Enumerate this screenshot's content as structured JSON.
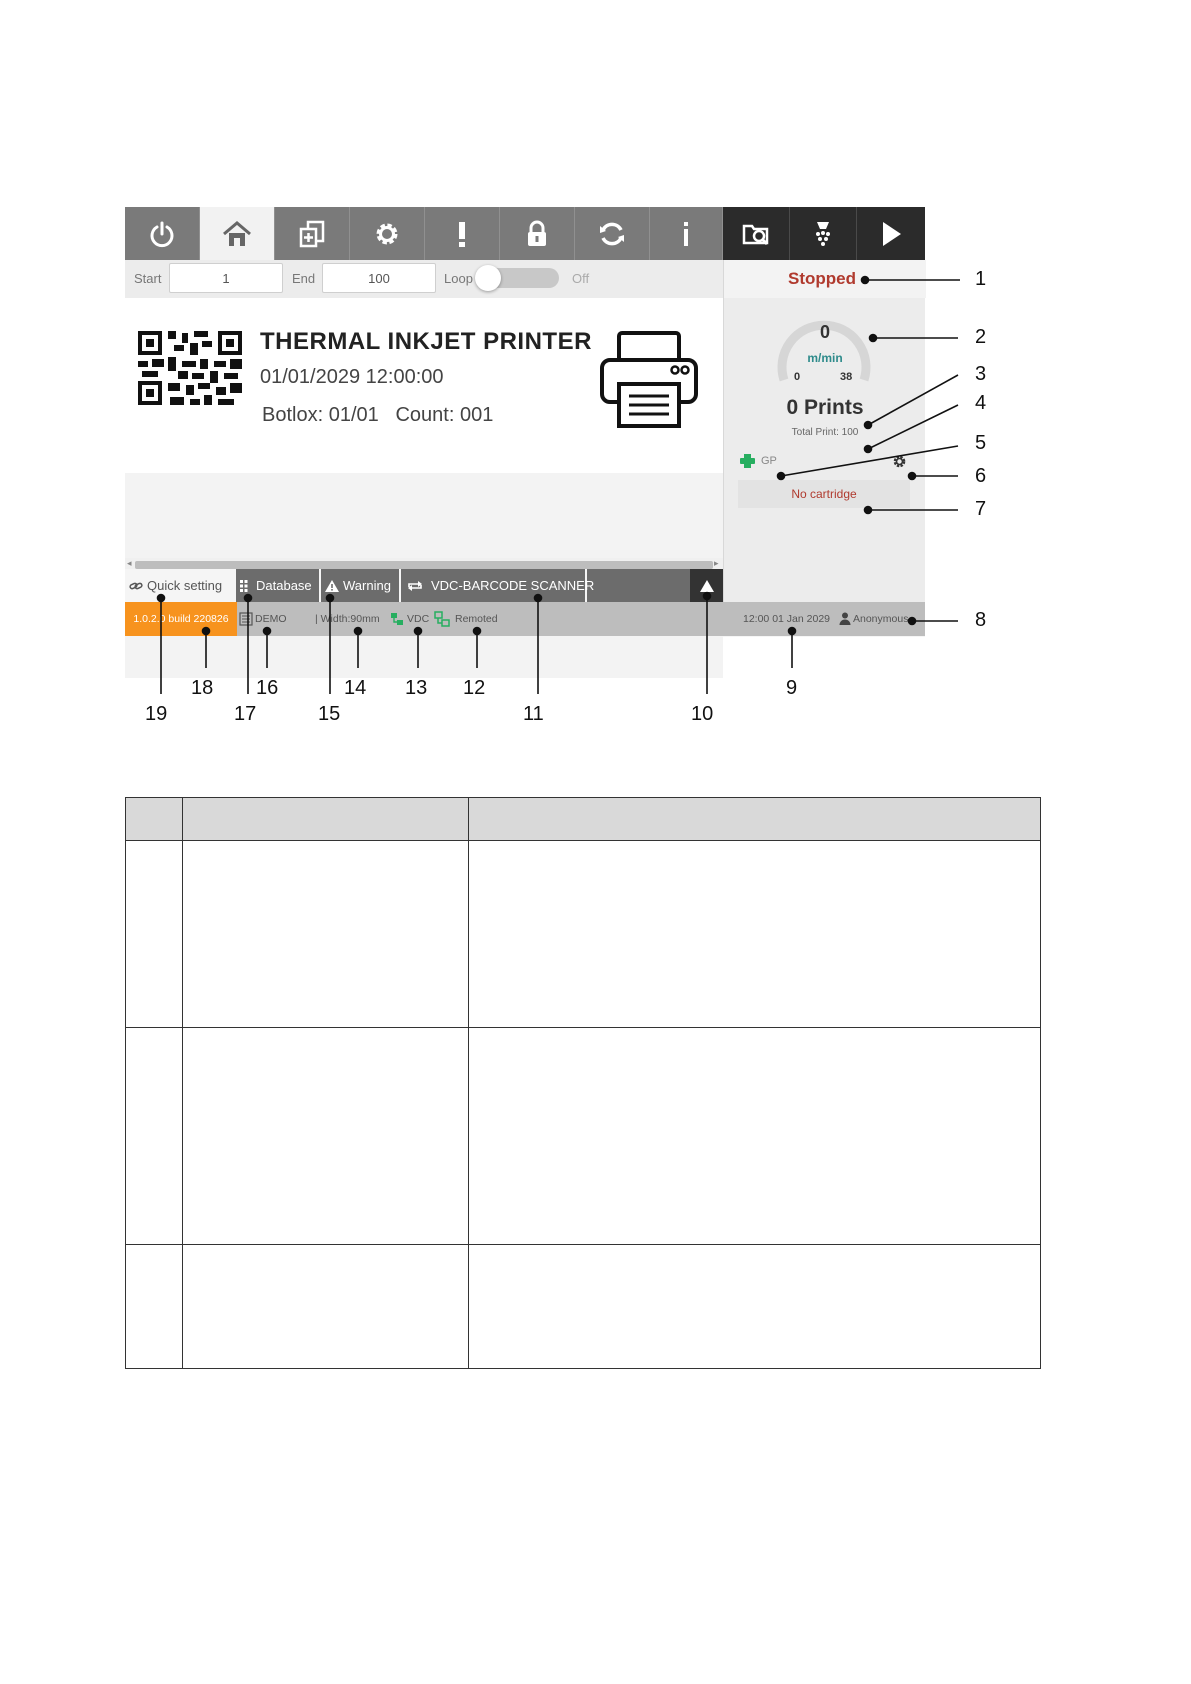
{
  "toolbar": {
    "buttons": [
      "power-icon",
      "home-icon",
      "new-file-icon",
      "gear-icon",
      "alert-icon",
      "lock-icon",
      "sync-icon",
      "info-icon",
      "folder-search-icon",
      "nozzle-icon",
      "play-icon"
    ]
  },
  "controls": {
    "start_label": "Start",
    "start_value": "1",
    "end_label": "End",
    "end_value": "100",
    "loop_label": "Loop",
    "loop_state": "Off"
  },
  "label": {
    "title": "THERMAL INKJET PRINTER",
    "datetime": "01/01/2029 12:00:00",
    "botlox_label": "Botlox:",
    "botlox_value": "01/01",
    "count_label": "Count:",
    "count_value": "001"
  },
  "side": {
    "status": "Stopped",
    "speed_value": "0",
    "speed_unit": "m/min",
    "gauge_min": "0",
    "gauge_max": "38",
    "prints": "0 Prints",
    "total_print": "Total Print: 100",
    "printhead": "GP",
    "cartridge": "No cartridge"
  },
  "tabs": {
    "quick": "Quick setting",
    "database": "Database",
    "warning": "Warning",
    "scanner": "VDC-BARCODE SCANNER"
  },
  "statusbar": {
    "version": "1.0.2.0 build 220826",
    "demo": "DEMO",
    "width": "| Width:90mm",
    "vdc": "VDC",
    "remoted": "Remoted",
    "datetime": "12:00 01 Jan 2029",
    "user": "Anonymous"
  },
  "callouts": [
    "1",
    "2",
    "3",
    "4",
    "5",
    "6",
    "7",
    "8",
    "9",
    "10",
    "11",
    "12",
    "13",
    "14",
    "15",
    "16",
    "17",
    "18",
    "19"
  ],
  "colors": {
    "status_stopped": "#b03a2e",
    "version_bg": "#f7931e",
    "printhead_icon": "#27ae60",
    "speed_unit": "#2e8b8b"
  }
}
